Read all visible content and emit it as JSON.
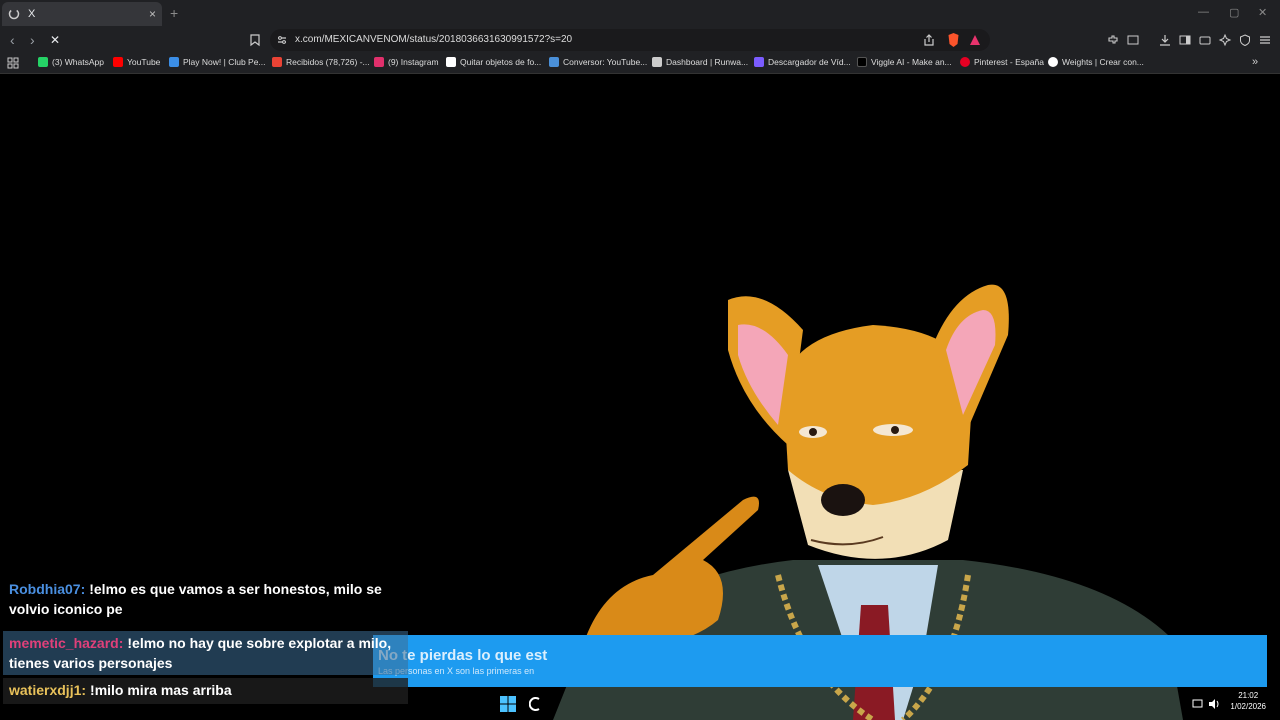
{
  "browser": {
    "tab": {
      "title": "X",
      "close": "×"
    },
    "new_tab": "+",
    "window_controls": [
      "—",
      "▢",
      "✕"
    ],
    "url": "x.com/MEXICANVENOM/status/2018036631630991572?s=20",
    "nav": {
      "back": "‹",
      "forward": "›",
      "stop": "✕"
    }
  },
  "bookmarks": [
    {
      "label": "(3) WhatsApp",
      "color": "#25d366"
    },
    {
      "label": "YouTube",
      "color": "#ff0000"
    },
    {
      "label": "Play Now! | Club Pe...",
      "color": "#3b8ee6"
    },
    {
      "label": "Recibidos (78,726) -...",
      "color": "#ea4335"
    },
    {
      "label": "(9) Instagram",
      "color": "#e1306c"
    },
    {
      "label": "Quitar objetos de fo...",
      "color": "#ffffff"
    },
    {
      "label": "Conversor: YouTube...",
      "color": "#4a90d9"
    },
    {
      "label": "Dashboard | Runwa...",
      "color": "#cccccc"
    },
    {
      "label": "Descargador de Víd...",
      "color": "#7b5cff"
    },
    {
      "label": "Viggle AI - Make an...",
      "color": "#000000"
    },
    {
      "label": "Pinterest - España",
      "color": "#e60023"
    },
    {
      "label": "Weights | Crear con...",
      "color": "#ffffff"
    }
  ],
  "banner": {
    "title": "No te pierdas lo que est",
    "subtitle": "Las personas en X son las primeras en"
  },
  "chat": [
    {
      "user": "Robdhia07:",
      "user_color": "#4a8fe0",
      "text": "!elmo es que vamos a ser honestos, milo se volvio iconico pe"
    },
    {
      "user": "memetic_hazard:",
      "user_color": "#e0407a",
      "text": "!elmo no hay que sobre explotar a milo, tienes varios personajes"
    },
    {
      "user": "watierxdjj1:",
      "user_color": "#e8c15a",
      "text": "!milo mira mas arriba"
    }
  ],
  "taskbar": {
    "time": "21:02",
    "date": "1/02/2026"
  }
}
